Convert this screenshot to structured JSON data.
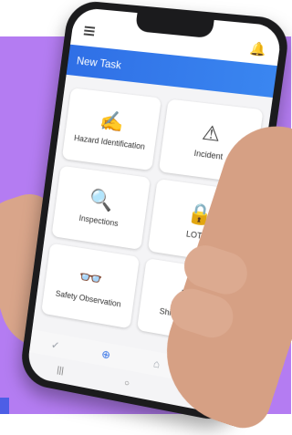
{
  "header": {
    "title": "New Task"
  },
  "tiles": [
    {
      "label": "Hazard Identification",
      "icon": "✍"
    },
    {
      "label": "Incident",
      "icon": "⚠"
    },
    {
      "label": "Inspections",
      "icon": "🔍"
    },
    {
      "label": "LOTO",
      "icon": "🔒"
    },
    {
      "label": "Safety Observation",
      "icon": "👓"
    },
    {
      "label": "Shift Handover",
      "icon": "⇄"
    }
  ],
  "bottom_nav": [
    {
      "icon": "check-circle-icon",
      "glyph": "✓"
    },
    {
      "icon": "add-circle-icon",
      "glyph": "⊕"
    },
    {
      "icon": "home-icon",
      "glyph": "⌂"
    },
    {
      "icon": "search-icon",
      "glyph": "○"
    }
  ],
  "system_bar": [
    {
      "icon": "recent-apps-icon",
      "glyph": "|||"
    },
    {
      "icon": "home-circle-icon",
      "glyph": "○"
    },
    {
      "icon": "back-icon",
      "glyph": "<"
    }
  ],
  "colors": {
    "accent": "#2f6fe6",
    "background": "#b47cf2"
  }
}
